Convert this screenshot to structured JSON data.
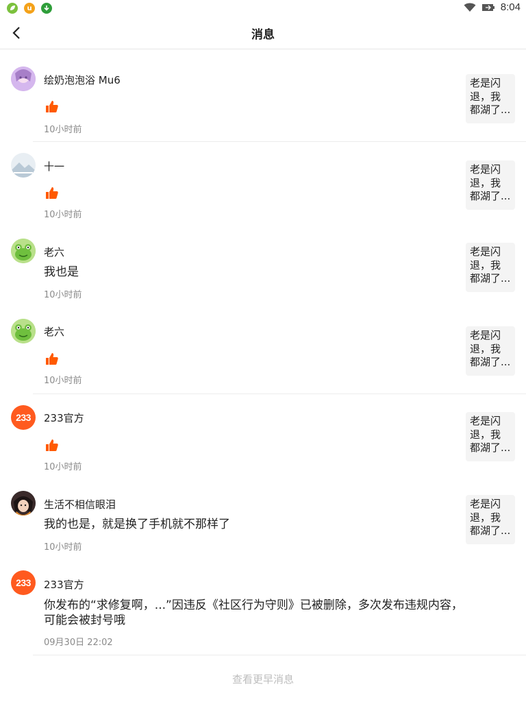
{
  "status_bar": {
    "time": "8:04"
  },
  "header": {
    "title": "消息"
  },
  "messages": [
    {
      "user": "绘奶泡泡浴 Mu6",
      "type": "like",
      "time": "10小时前",
      "thumb": [
        "老是闪",
        "退，我",
        "都湖了..."
      ]
    },
    {
      "user": "十一",
      "type": "like",
      "time": "10小时前",
      "thumb": [
        "老是闪",
        "退，我",
        "都湖了..."
      ]
    },
    {
      "user": "老六",
      "type": "comment",
      "text": "我也是",
      "time": "10小时前",
      "thumb": [
        "老是闪",
        "退，我",
        "都湖了..."
      ]
    },
    {
      "user": "老六",
      "type": "like",
      "time": "10小时前",
      "thumb": [
        "老是闪",
        "退，我",
        "都湖了..."
      ]
    },
    {
      "user": "233官方",
      "type": "like",
      "time": "10小时前",
      "thumb": [
        "老是闪",
        "退，我",
        "都湖了..."
      ]
    },
    {
      "user": "生活不相信眼泪",
      "type": "comment",
      "text": "我的也是，就是换了手机就不那样了",
      "time": "10小时前",
      "thumb": [
        "老是闪",
        "退，我",
        "都湖了..."
      ]
    },
    {
      "user": "233官方",
      "type": "notice",
      "text_line1": "你发布的“求修复啊，...”因违反《社区行为守则》已被删除，多次发布违规内容，",
      "text_line2": "可能会被封号哦",
      "time": "09月30日 22:02"
    }
  ],
  "footer": {
    "more_label": "查看更早消息"
  },
  "avatar_badge_text": "233",
  "colors": {
    "accent": "#ff5a1f",
    "like": "#ff5a00",
    "divider": "#ececec"
  }
}
